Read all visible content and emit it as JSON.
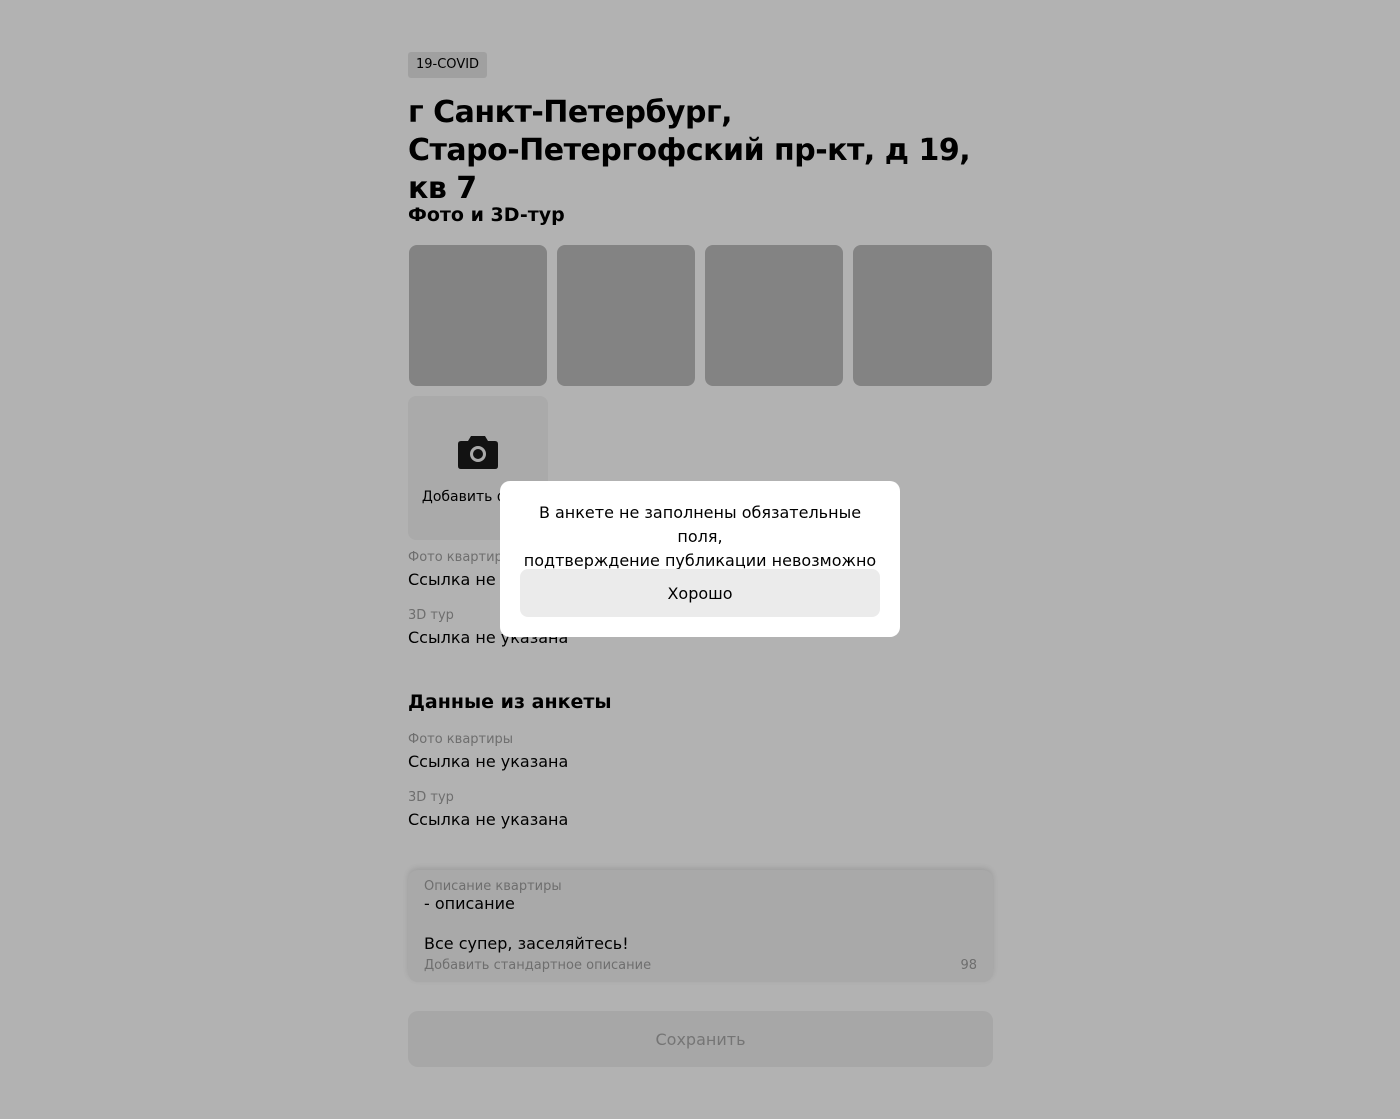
{
  "badge": "19-COVID",
  "title_line1": "г Санкт-Петербург,",
  "title_line2": "Старо-Петергофский пр-кт, д 19, кв 7",
  "photos_section": {
    "heading": "Фото и 3D-тур",
    "add_photo_label": "Добавить фото",
    "photo_link_label": "Фото квартиры",
    "photo_link_value": "Ссылка не указана",
    "tour_label": "3D тур",
    "tour_value": "Ссылка не указана"
  },
  "form_section": {
    "heading": "Данные из анкеты",
    "photo_link_label": "Фото квартиры",
    "photo_link_value": "Ссылка не указана",
    "tour_label": "3D тур",
    "tour_value": "Ссылка не указана"
  },
  "description": {
    "label": "Описание квартиры",
    "line1": "- описание",
    "line2": "Все супер, заселяйтесь!",
    "add_standard": "Добавить стандартное описание",
    "counter": "98"
  },
  "save_label": "Сохранить",
  "modal": {
    "line1": "В анкете не заполнены обязательные поля,",
    "line2": "подтверждение публикации невозможно",
    "ok_label": "Хорошо"
  },
  "icons": {
    "add_photo": "camera-icon"
  }
}
